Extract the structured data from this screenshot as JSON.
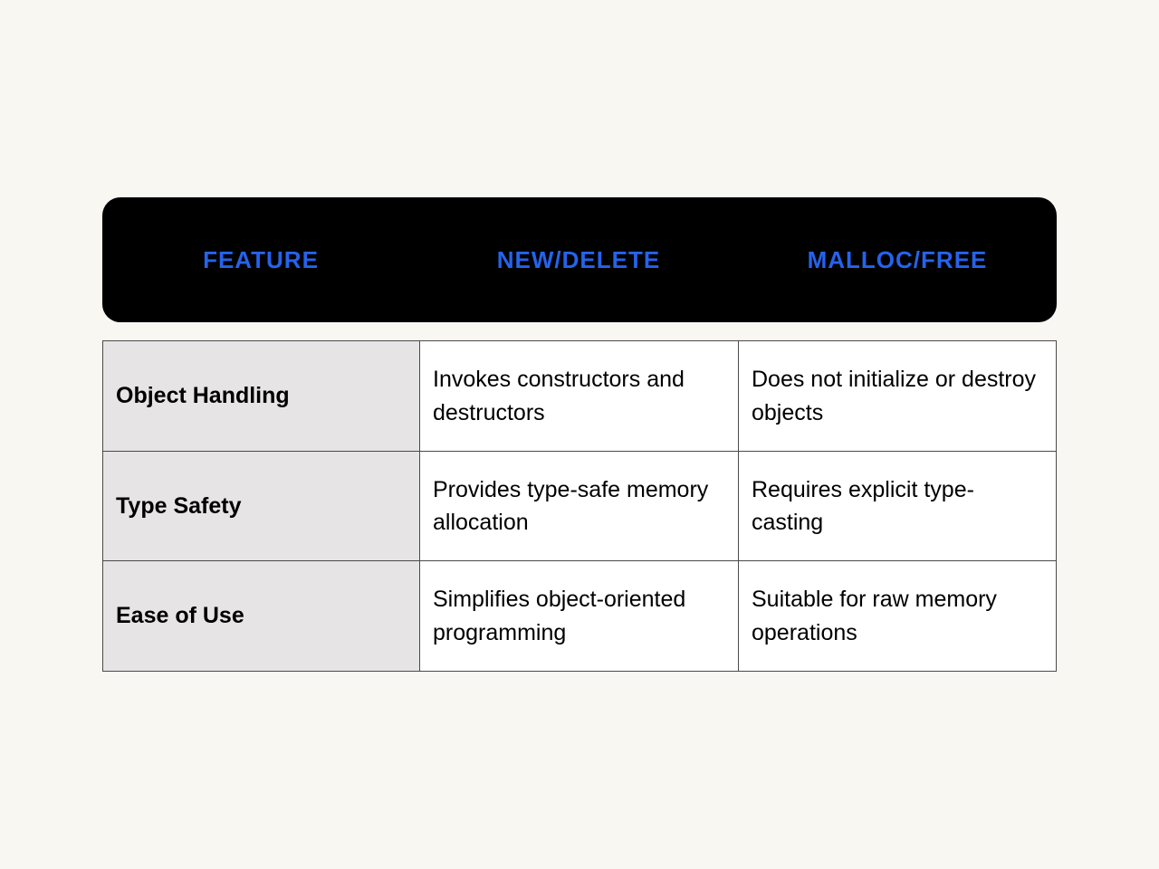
{
  "table": {
    "headers": {
      "col1": "FEATURE",
      "col2": "NEW/DELETE",
      "col3": "MALLOC/FREE"
    },
    "rows": [
      {
        "feature": "Object Handling",
        "new_delete": "Invokes constructors and destructors",
        "malloc_free": "Does not initialize or destroy objects"
      },
      {
        "feature": "Type Safety",
        "new_delete": "Provides type-safe memory allocation",
        "malloc_free": "Requires explicit type-casting"
      },
      {
        "feature": "Ease of Use",
        "new_delete": "Simplifies object-oriented programming",
        "malloc_free": "Suitable for raw memory operations"
      }
    ]
  }
}
